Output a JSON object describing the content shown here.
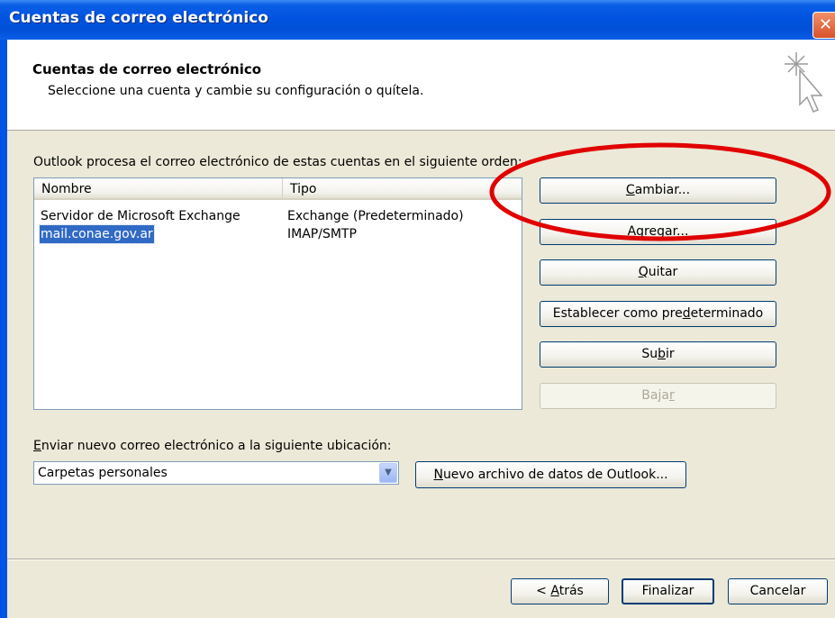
{
  "window": {
    "title": "Cuentas de correo electrónico",
    "close_icon": "close-icon"
  },
  "header": {
    "title": "Cuentas de correo electrónico",
    "subtitle": "Seleccione una cuenta y cambie su configuración o quítela.",
    "icon": "sparkle-cursor-icon"
  },
  "accounts": {
    "order_label": "Outlook procesa el correo electrónico de estas cuentas en el siguiente orden:",
    "columns": {
      "name": "Nombre",
      "type": "Tipo"
    },
    "rows": [
      {
        "name": "Servidor de Microsoft Exchange",
        "type": "Exchange (Predeterminado)",
        "selected": false
      },
      {
        "name": "mail.conae.gov.ar",
        "type": "IMAP/SMTP",
        "selected": true
      }
    ]
  },
  "buttons": {
    "change": {
      "label": "Cambiar...",
      "accesskey": "C",
      "enabled": true
    },
    "add": {
      "label": "Agregar...",
      "accesskey": "g",
      "enabled": true
    },
    "remove": {
      "label": "Quitar",
      "accesskey": "Q",
      "enabled": true
    },
    "set_default": {
      "label": "Establecer como predeterminado",
      "accesskey": "d",
      "enabled": true
    },
    "up": {
      "label": "Subir",
      "accesskey": "b",
      "enabled": true
    },
    "down": {
      "label": "Bajar",
      "accesskey": "r",
      "enabled": false
    }
  },
  "delivery": {
    "label": "Enviar nuevo correo electrónico a la siguiente ubicación:",
    "label_accesskey": "E",
    "selected": "Carpetas personales",
    "new_data_file_label": "Nuevo archivo de datos de Outlook...",
    "new_data_file_accesskey": "N"
  },
  "footer": {
    "back": {
      "label": "< Atrás",
      "accesskey": "A"
    },
    "finish": {
      "label": "Finalizar"
    },
    "cancel": {
      "label": "Cancelar"
    }
  },
  "colors": {
    "annotation_ellipse": "#e00000",
    "selection": "#316ac5",
    "titlebar": "#0054e3"
  }
}
